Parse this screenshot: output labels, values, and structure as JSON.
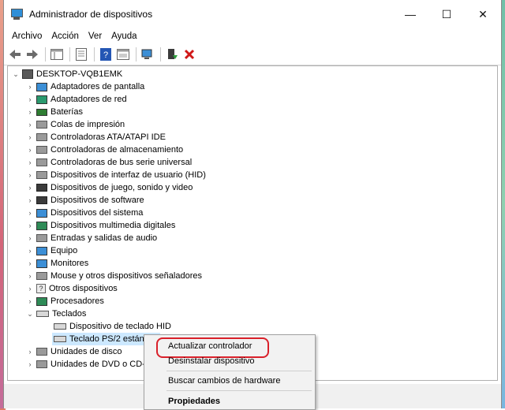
{
  "window": {
    "title": "Administrador de dispositivos",
    "minimize": "—",
    "maximize": "☐",
    "close": "✕"
  },
  "menu": [
    "Archivo",
    "Acción",
    "Ver",
    "Ayuda"
  ],
  "tree": {
    "root": "DESKTOP-VQB1EMK",
    "categories": [
      "Adaptadores de pantalla",
      "Adaptadores de red",
      "Baterías",
      "Colas de impresión",
      "Controladoras ATA/ATAPI IDE",
      "Controladoras de almacenamiento",
      "Controladoras de bus serie universal",
      "Dispositivos de interfaz de usuario (HID)",
      "Dispositivos de juego, sonido y video",
      "Dispositivos de software",
      "Dispositivos del sistema",
      "Dispositivos multimedia digitales",
      "Entradas y salidas de audio",
      "Equipo",
      "Monitores",
      "Mouse y otros dispositivos señaladores",
      "Otros dispositivos",
      "Procesadores"
    ],
    "expanded": "Teclados",
    "keyboard_children": [
      "Dispositivo de teclado HID",
      "Teclado PS/2 estándar"
    ],
    "after": [
      "Unidades de disco",
      "Unidades de DVD o CD-R"
    ]
  },
  "context_menu": {
    "update": "Actualizar controlador",
    "uninstall": "Desinstalar dispositivo",
    "scan": "Buscar cambios de hardware",
    "properties": "Propiedades"
  }
}
